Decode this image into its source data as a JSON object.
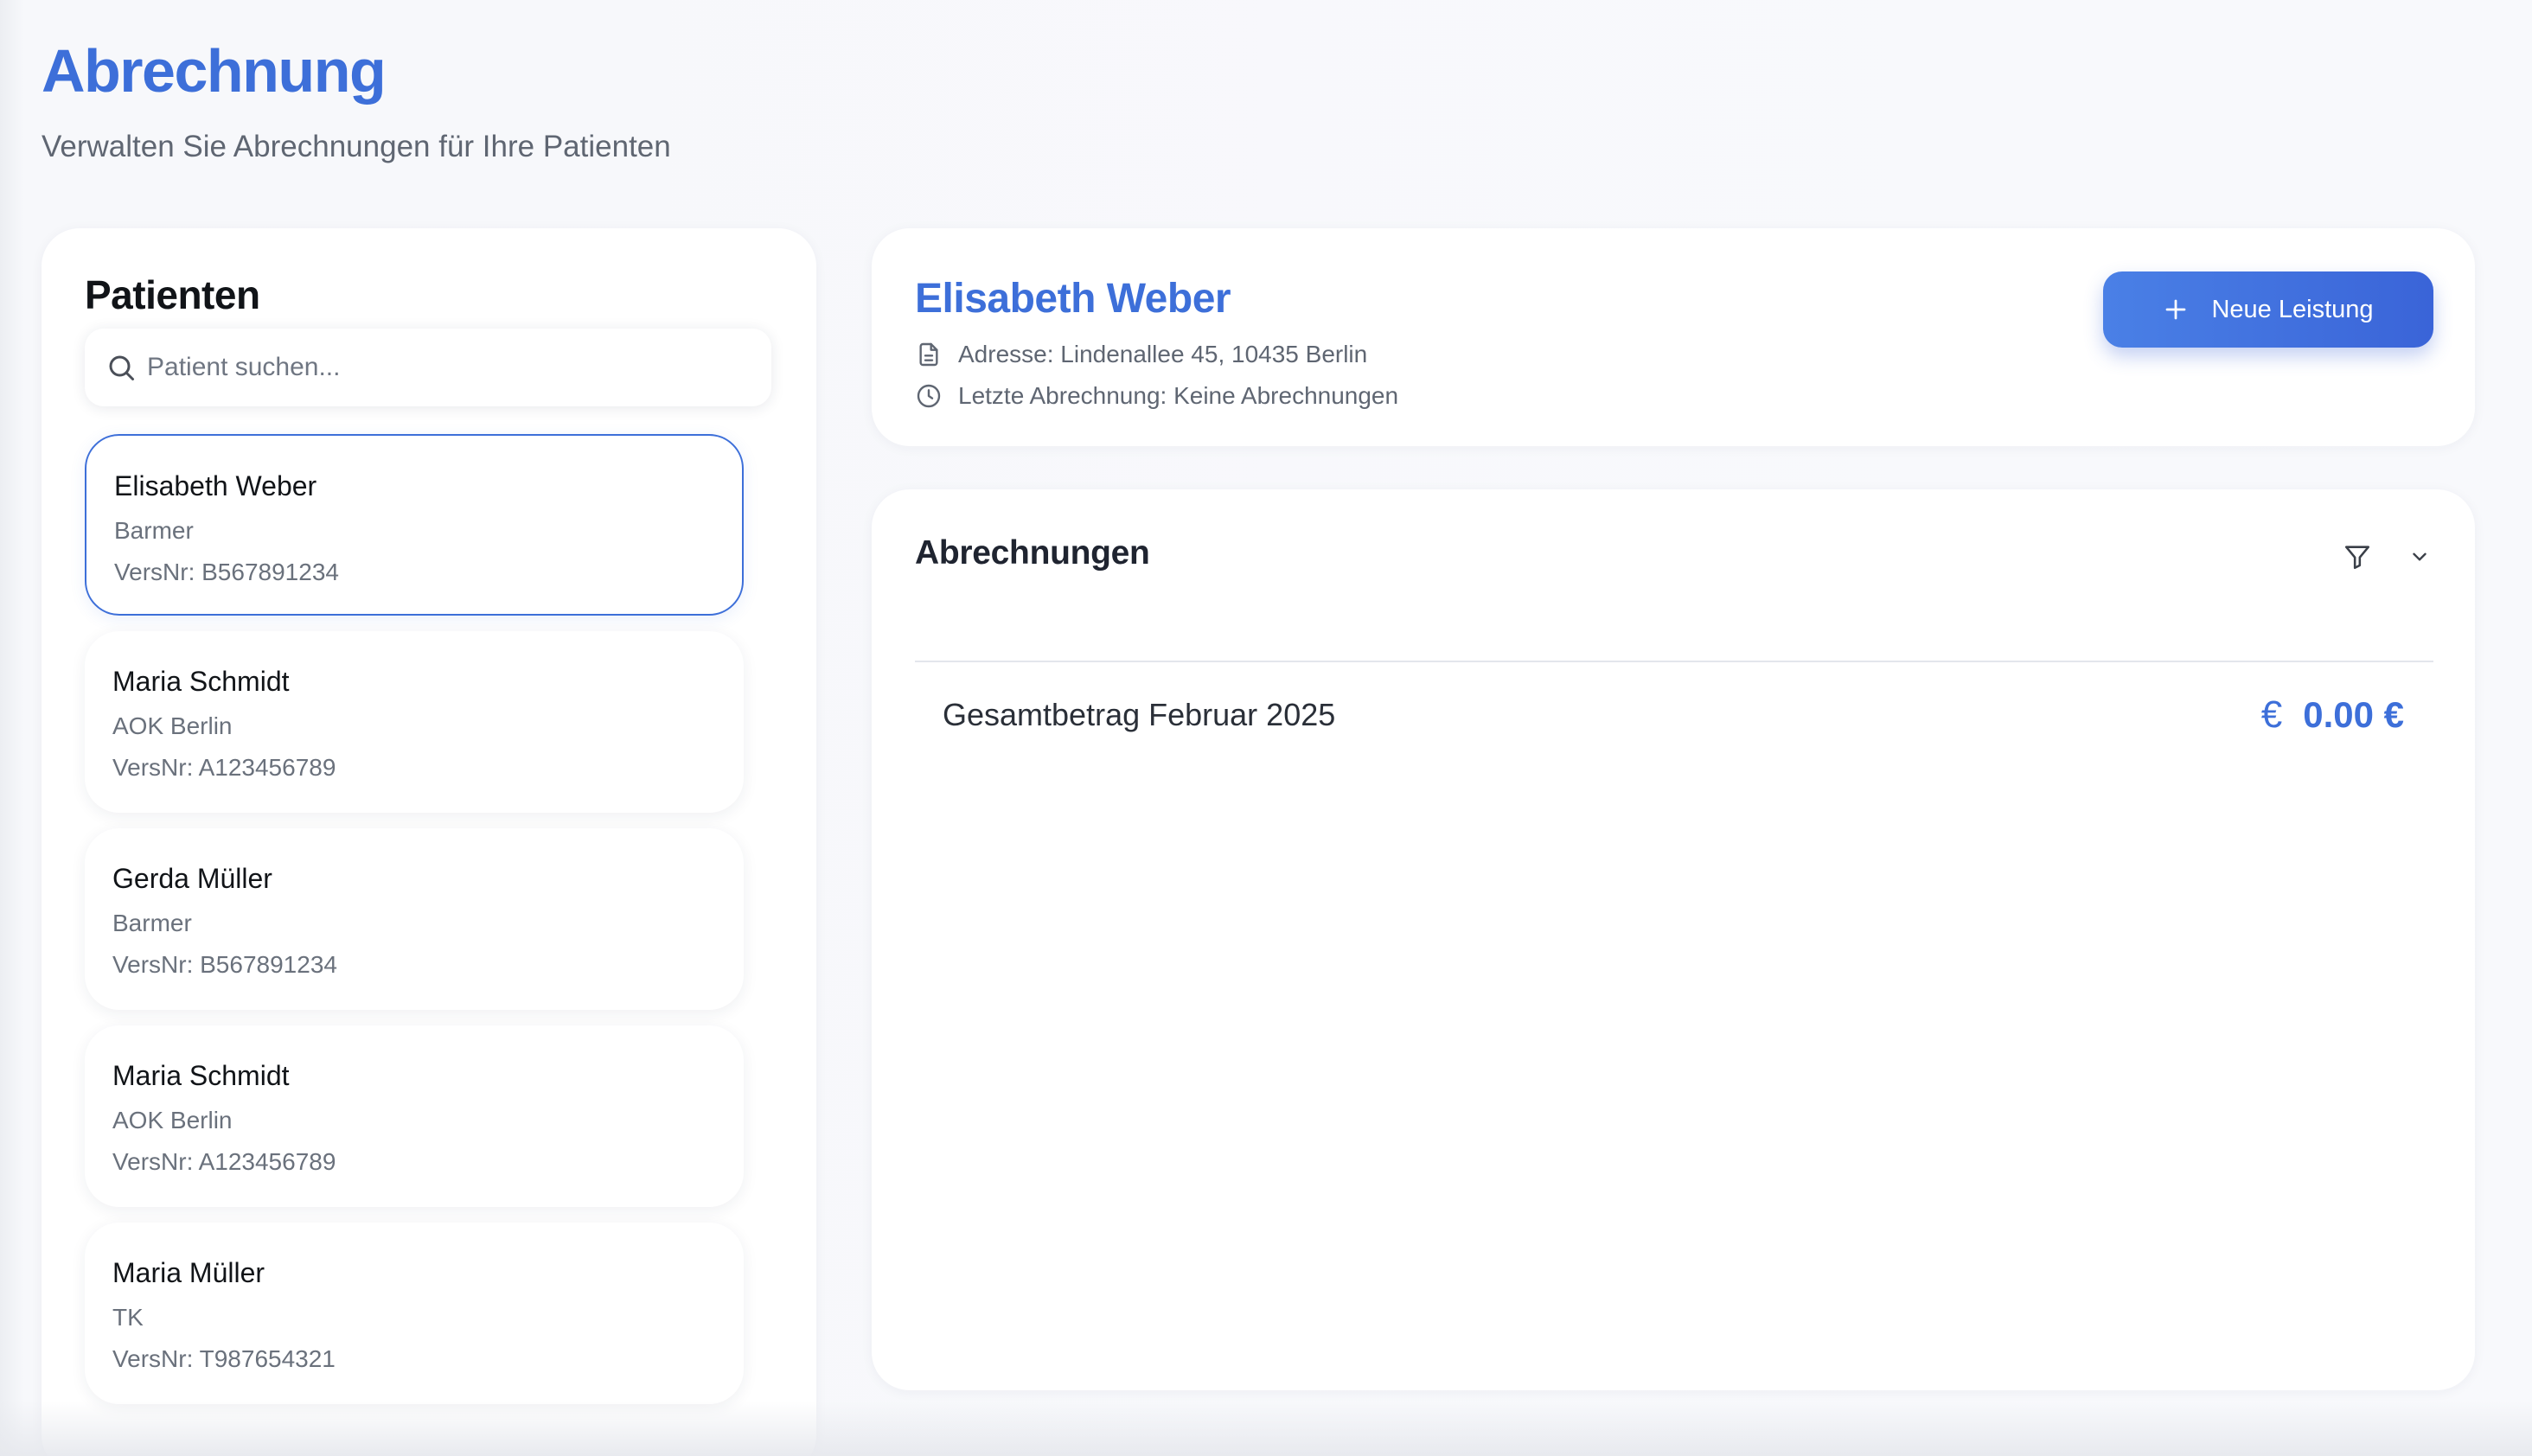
{
  "header": {
    "title": "Abrechnung",
    "subtitle": "Verwalten Sie Abrechnungen für Ihre Patienten"
  },
  "patients_panel": {
    "heading": "Patienten",
    "search": {
      "placeholder": "Patient suchen...",
      "value": ""
    },
    "patients": [
      {
        "name": "Elisabeth Weber",
        "insurer": "Barmer",
        "versnr": "VersNr: B567891234",
        "selected": true
      },
      {
        "name": "Maria Schmidt",
        "insurer": "AOK Berlin",
        "versnr": "VersNr: A123456789",
        "selected": false
      },
      {
        "name": "Gerda Müller",
        "insurer": "Barmer",
        "versnr": "VersNr: B567891234",
        "selected": false
      },
      {
        "name": "Maria Schmidt",
        "insurer": "AOK Berlin",
        "versnr": "VersNr: A123456789",
        "selected": false
      },
      {
        "name": "Maria Müller",
        "insurer": "TK",
        "versnr": "VersNr: T987654321",
        "selected": false
      }
    ]
  },
  "patient_info": {
    "name": "Elisabeth Weber",
    "address": "Adresse: Lindenallee 45, 10435 Berlin",
    "last_billing": "Letzte Abrechnung: Keine Abrechnungen",
    "new_button_label": "Neue Leistung",
    "icons": {
      "address": "document-icon",
      "last_billing": "clock-icon",
      "new_button": "plus-icon"
    }
  },
  "billing": {
    "title": "Abrechnungen",
    "total_label": "Gesamtbetrag Februar 2025",
    "total_amount": "0.00 €",
    "icons": {
      "filter": "filter-icon",
      "collapse": "chevron-down-icon",
      "currency": "euro-icon"
    }
  },
  "colors": {
    "accent": "#3d6fd9",
    "button_gradient_start": "#4a80e6",
    "button_gradient_end": "#3a64d8",
    "background": "#f7f8fb",
    "card": "#ffffff",
    "muted_text": "#6a717c"
  }
}
